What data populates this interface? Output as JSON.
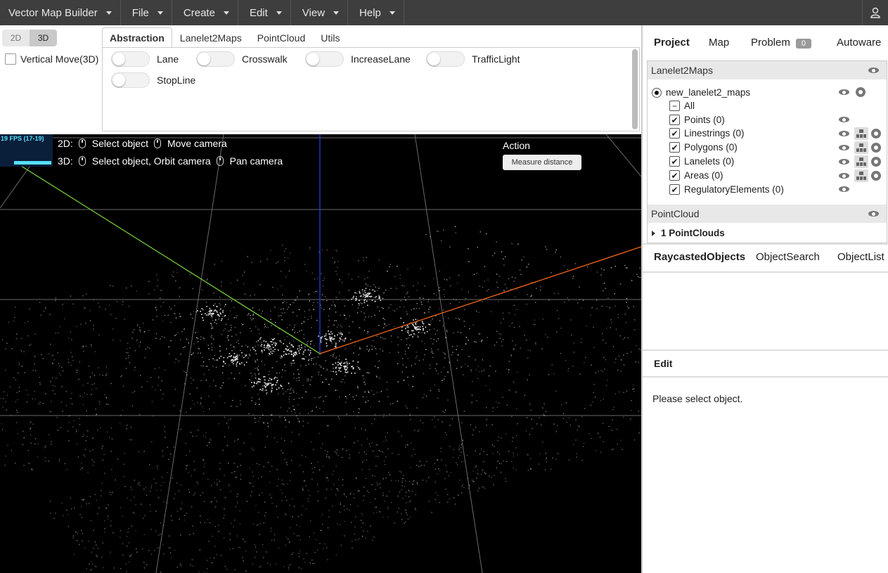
{
  "menubar": {
    "app_title": "Vector Map Builder",
    "items": [
      "File",
      "Create",
      "Edit",
      "View",
      "Help"
    ]
  },
  "toolbar": {
    "dim_2d": "2D",
    "dim_3d": "3D",
    "vertical_move": "Vertical Move(3D)",
    "tabs": [
      "Abstraction",
      "Lanelet2Maps",
      "PointCloud",
      "Utils"
    ],
    "toggles": [
      "Lane",
      "Crosswalk",
      "IncreaseLane",
      "TrafficLight",
      "StopLine"
    ]
  },
  "viewport": {
    "fps": "19 FPS (17-19)",
    "hint_2d_prefix": "2D:",
    "hint_2d_left": "Select object",
    "hint_2d_right": "Move camera",
    "hint_3d_prefix": "3D:",
    "hint_3d_left": "Select object, Orbit camera",
    "hint_3d_right": "Pan camera",
    "action_label": "Action",
    "measure_button": "Measure distance"
  },
  "right": {
    "tabs": [
      "Project",
      "Map",
      "Problem",
      "Autoware"
    ],
    "problem_count": "0",
    "lanelet_section": "Lanelet2Maps",
    "map_name": "new_lanelet2_maps",
    "all_label": "All",
    "layers": [
      "Points (0)",
      "Linestrings (0)",
      "Polygons (0)",
      "Lanelets (0)",
      "Areas (0)",
      "RegulatoryElements (0)"
    ],
    "pointcloud_section": "PointCloud",
    "pointcloud_item": "1 PointClouds",
    "object_tabs": [
      "RaycastedObjects",
      "ObjectSearch",
      "ObjectList"
    ],
    "edit_title": "Edit",
    "edit_message": "Please select object."
  },
  "colors": {
    "menubar": "#3e3e3e",
    "viewport_bg": "#000000",
    "fps_text": "#56e0ff",
    "axis_x": "#ff6a1a",
    "axis_y": "#7cd63a",
    "axis_z": "#2a3cff"
  }
}
